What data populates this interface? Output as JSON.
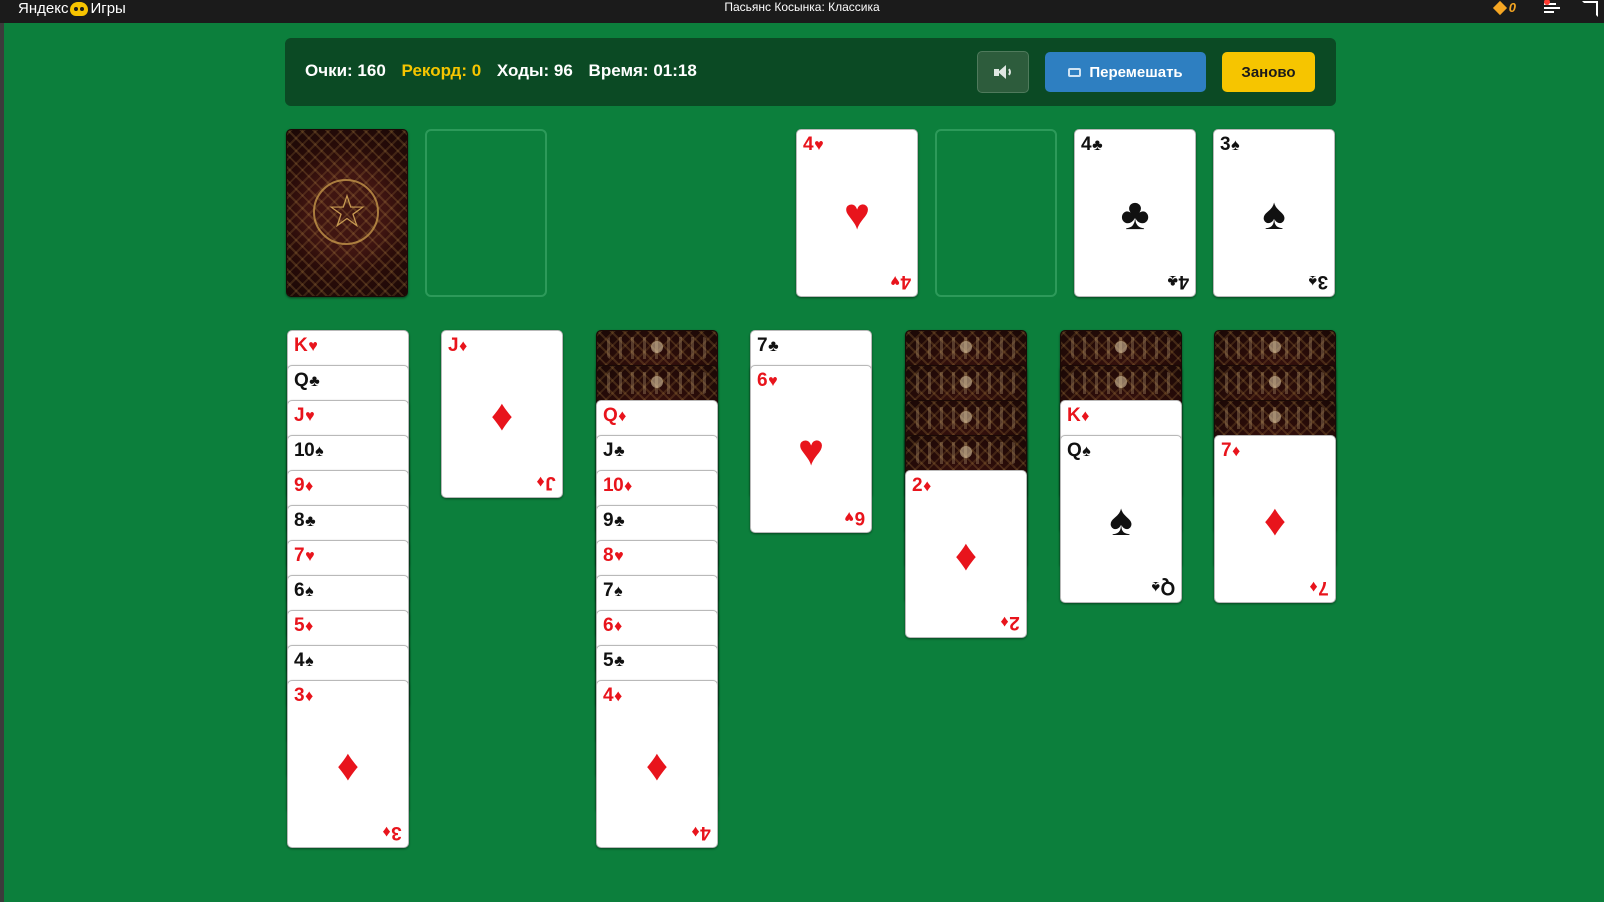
{
  "topbar": {
    "brand_left": "Яндекс",
    "brand_right": "Игры",
    "brand_icon": "gamepad-icon",
    "title": "Пасьянс Косынка: Классика",
    "coins": "0"
  },
  "stats": {
    "score": "Очки: 160",
    "record": "Рекорд: 0",
    "moves": "Ходы: 96",
    "time": "Время: 01:18"
  },
  "buttons": {
    "sound_icon": "speaker-icon",
    "shuffle_label": "Перемешать",
    "new_label": "Заново"
  },
  "colors": {
    "table": "#0c7f3c",
    "panel": "#0b4a24",
    "record": "#f6c500",
    "shuffle_button": "#2e7fc1",
    "new_button": "#f6c500",
    "red_suit": "#e8141c"
  },
  "stock": {
    "face_down": true
  },
  "waste": {
    "empty": true
  },
  "foundations": [
    {
      "rank": "4",
      "suit": "♥",
      "color": "red"
    },
    {
      "empty": true
    },
    {
      "rank": "4",
      "suit": "♣",
      "color": "black"
    },
    {
      "rank": "3",
      "suit": "♠",
      "color": "black"
    }
  ],
  "tableau": [
    {
      "face_down": 0,
      "cards": [
        {
          "rank": "K",
          "suit": "♥",
          "color": "red"
        },
        {
          "rank": "Q",
          "suit": "♣",
          "color": "black"
        },
        {
          "rank": "J",
          "suit": "♥",
          "color": "red"
        },
        {
          "rank": "10",
          "suit": "♠",
          "color": "black"
        },
        {
          "rank": "9",
          "suit": "♦",
          "color": "red"
        },
        {
          "rank": "8",
          "suit": "♣",
          "color": "black"
        },
        {
          "rank": "7",
          "suit": "♥",
          "color": "red"
        },
        {
          "rank": "6",
          "suit": "♠",
          "color": "black"
        },
        {
          "rank": "5",
          "suit": "♦",
          "color": "red"
        },
        {
          "rank": "4",
          "suit": "♠",
          "color": "black"
        },
        {
          "rank": "3",
          "suit": "♦",
          "color": "red"
        }
      ]
    },
    {
      "face_down": 0,
      "cards": [
        {
          "rank": "J",
          "suit": "♦",
          "color": "red"
        }
      ]
    },
    {
      "face_down": 2,
      "cards": [
        {
          "rank": "Q",
          "suit": "♦",
          "color": "red"
        },
        {
          "rank": "J",
          "suit": "♣",
          "color": "black"
        },
        {
          "rank": "10",
          "suit": "♦",
          "color": "red"
        },
        {
          "rank": "9",
          "suit": "♣",
          "color": "black"
        },
        {
          "rank": "8",
          "suit": "♥",
          "color": "red"
        },
        {
          "rank": "7",
          "suit": "♠",
          "color": "black"
        },
        {
          "rank": "6",
          "suit": "♦",
          "color": "red"
        },
        {
          "rank": "5",
          "suit": "♣",
          "color": "black"
        },
        {
          "rank": "4",
          "suit": "♦",
          "color": "red"
        }
      ]
    },
    {
      "face_down": 0,
      "cards": [
        {
          "rank": "7",
          "suit": "♣",
          "color": "black"
        },
        {
          "rank": "6",
          "suit": "♥",
          "color": "red"
        }
      ]
    },
    {
      "face_down": 4,
      "cards": [
        {
          "rank": "2",
          "suit": "♦",
          "color": "red"
        }
      ]
    },
    {
      "face_down": 2,
      "cards": [
        {
          "rank": "K",
          "suit": "♦",
          "color": "red"
        },
        {
          "rank": "Q",
          "suit": "♠",
          "color": "black"
        }
      ]
    },
    {
      "face_down": 3,
      "cards": [
        {
          "rank": "7",
          "suit": "♦",
          "color": "red"
        }
      ]
    }
  ]
}
